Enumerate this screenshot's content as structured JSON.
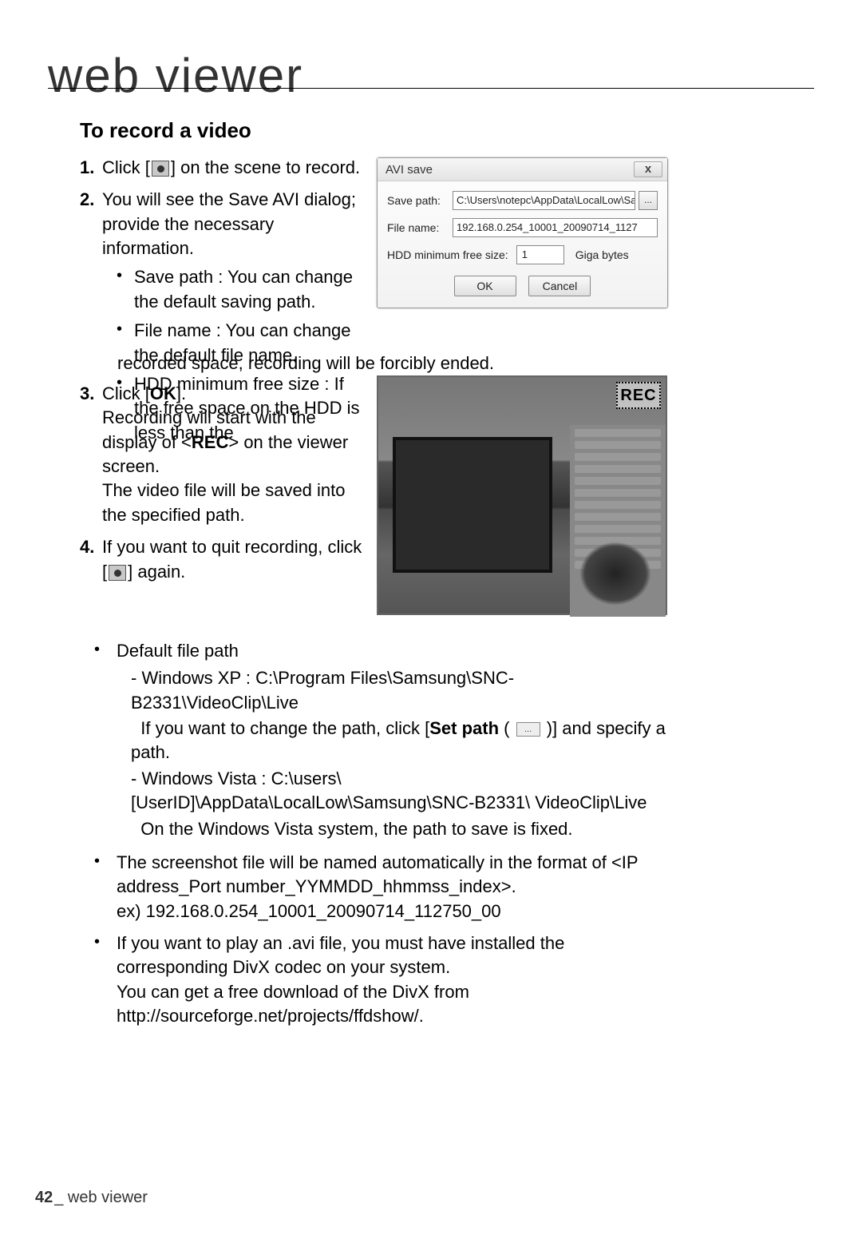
{
  "page": {
    "title": "web viewer",
    "footer_page": "42",
    "footer_label": "_ web viewer"
  },
  "section": {
    "heading": "To record a video"
  },
  "steps": {
    "s1": {
      "num": "1.",
      "text_a": "Click [",
      "text_b": "] on the scene to record."
    },
    "s2": {
      "num": "2.",
      "text": "You will see the Save AVI dialog; provide the necessary information.",
      "sub": {
        "a": "Save path : You can change the default saving path.",
        "b": "File name : You can change the default file name.",
        "c_a": "HDD minimum free size : If the free space on the HDD is less than the",
        "c_overflow": "recorded space, recording will be forcibly ended."
      }
    },
    "s3": {
      "num": "3.",
      "line1_a": "Click [",
      "line1_ok": "OK",
      "line1_b": "].",
      "line2_a": "Recording will start with the display of <",
      "line2_rec": "REC",
      "line2_b": "> on the viewer screen.",
      "line3": "The video file will be saved into the specified path."
    },
    "s4": {
      "num": "4.",
      "text_a": "If you want to quit recording, click [",
      "text_b": "] again."
    }
  },
  "dialog": {
    "title": "AVI save",
    "save_path_label": "Save path:",
    "save_path_value": "C:\\Users\\notepc\\AppData\\LocalLow\\Sam",
    "browse": "...",
    "file_name_label": "File name:",
    "file_name_value": "192.168.0.254_10001_20090714_1127",
    "hdd_label": "HDD minimum free size:",
    "hdd_value": "1",
    "hdd_unit": "Giga bytes",
    "ok": "OK",
    "cancel": "Cancel",
    "close": "x"
  },
  "preview": {
    "rec_label": "REC"
  },
  "lower": {
    "b1": {
      "title": "Default file path",
      "xp1": "- Windows XP : C:\\Program Files\\Samsung\\SNC-B2331\\VideoClip\\Live",
      "xp2_a": "If you want to change the path, click [",
      "xp2_bold": "Set path",
      "xp2_b": " ( ",
      "xp2_c": " )] and specify a path.",
      "vista1": "- Windows Vista : C:\\users\\[UserID]\\AppData\\LocalLow\\Samsung\\SNC-B2331\\ VideoClip\\Live",
      "vista2": "On the Windows Vista system, the path to save is fixed."
    },
    "b2": {
      "l1": "The screenshot file will be named automatically in the format of <IP address_Port number_YYMMDD_hhmmss_index>.",
      "l2": "ex) 192.168.0.254_10001_20090714_112750_00"
    },
    "b3": {
      "l1": "If you want to play an .avi file, you must have installed the corresponding DivX codec on your system.",
      "l2": "You can get a free download of the DivX from http://sourceforge.net/projects/ffdshow/."
    }
  }
}
